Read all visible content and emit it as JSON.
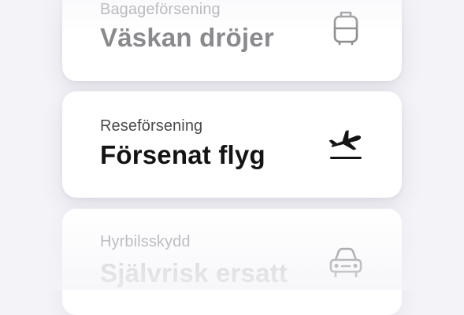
{
  "cards": [
    {
      "label": "Bagageförsening",
      "title": "Väskan dröjer",
      "icon": "suitcase-icon"
    },
    {
      "label": "Reseförsening",
      "title": "Försenat flyg",
      "icon": "airplane-departure-icon"
    },
    {
      "label": "Hyrbilsskydd",
      "title": "Självrisk ersatt",
      "icon": "car-icon"
    }
  ],
  "colors": {
    "background": "#f4f3f8",
    "card": "#ffffff",
    "title": "#141416",
    "label": "#4a4a4e"
  }
}
